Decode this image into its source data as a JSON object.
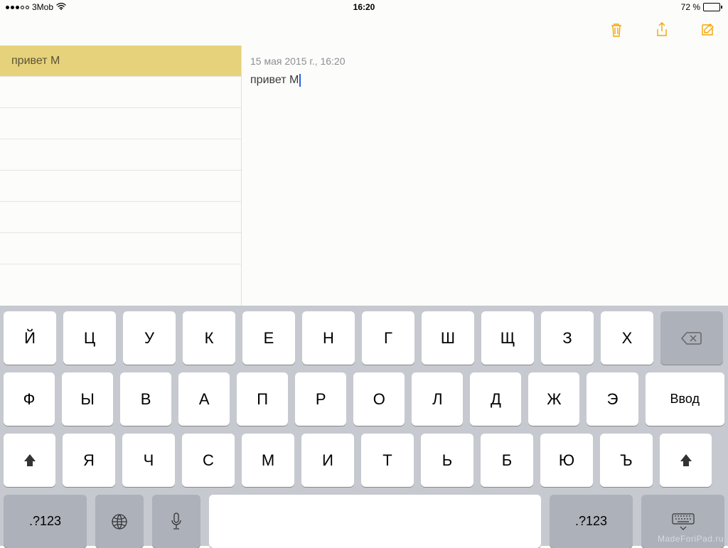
{
  "status": {
    "carrier": "3Mob",
    "time": "16:20",
    "battery_text": "72 %"
  },
  "sidebar": {
    "items": [
      {
        "title": "привет М",
        "selected": true
      }
    ]
  },
  "editor": {
    "date": "15 мая 2015 г., 16:20",
    "body": "привет М"
  },
  "keyboard": {
    "row1": [
      "Й",
      "Ц",
      "У",
      "К",
      "Е",
      "Н",
      "Г",
      "Ш",
      "Щ",
      "З",
      "Х"
    ],
    "row2": [
      "Ф",
      "Ы",
      "В",
      "А",
      "П",
      "Р",
      "О",
      "Л",
      "Д",
      "Ж",
      "Э"
    ],
    "row3": [
      "Я",
      "Ч",
      "С",
      "М",
      "И",
      "Т",
      "Ь",
      "Б",
      "Ю",
      "Ъ"
    ],
    "enter_label": "Ввод",
    "numbers_label": ".?123"
  },
  "watermark": "MadeForiPad.ru"
}
